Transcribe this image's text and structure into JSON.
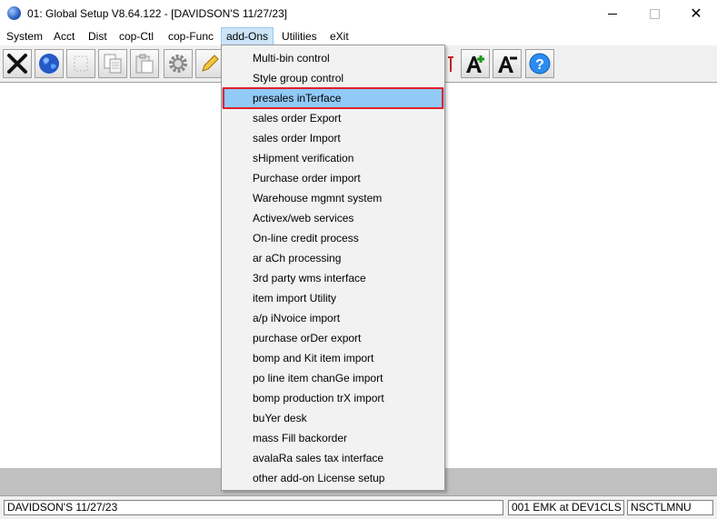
{
  "window": {
    "title": "01: Global Setup V8.64.122 - [DAVIDSON'S 11/27/23]",
    "minimize_glyph": "",
    "maximize_glyph": "",
    "close_glyph": "✕"
  },
  "menubar": {
    "items": [
      {
        "label": "System"
      },
      {
        "label": "Acct"
      },
      {
        "label": "Dist"
      },
      {
        "label": "cop-Ctl"
      },
      {
        "label": "cop-Func"
      },
      {
        "label": "add-Ons"
      },
      {
        "label": "Utilities"
      },
      {
        "label": "eXit"
      }
    ],
    "active_index": 5
  },
  "toolbar": {
    "icons": [
      "close-x-icon",
      "globe-icon",
      "blank-icon",
      "copy-icon",
      "paste-icon",
      "settings-gear-icon",
      "edit-pencil-icon",
      "text-icon",
      "font-increase-icon",
      "font-decrease-icon",
      "help-icon"
    ]
  },
  "dropdown": {
    "items": [
      {
        "label": "Multi-bin control"
      },
      {
        "label": "Style group control"
      },
      {
        "label": "presales inTerface"
      },
      {
        "label": "sales order Export"
      },
      {
        "label": "sales order Import"
      },
      {
        "label": "sHipment verification"
      },
      {
        "label": "Purchase order import"
      },
      {
        "label": "Warehouse mgmnt system"
      },
      {
        "label": "Activex/web services"
      },
      {
        "label": "On-line credit process"
      },
      {
        "label": "ar aCh processing"
      },
      {
        "label": "3rd party wms interface"
      },
      {
        "label": "item import Utility"
      },
      {
        "label": "a/p iNvoice import"
      },
      {
        "label": "purchase orDer export"
      },
      {
        "label": "bomp and Kit item import"
      },
      {
        "label": "po line item chanGe import"
      },
      {
        "label": "bomp production trX import"
      },
      {
        "label": "buYer desk"
      },
      {
        "label": "mass Fill backorder"
      },
      {
        "label": "avalaRa sales tax interface"
      },
      {
        "label": "other add-on License setup"
      }
    ],
    "highlighted_index": 2
  },
  "statusbar": {
    "company": "DAVIDSON'S 11/27/23",
    "session": "001 EMK at DEV1CLS",
    "program": "NSCTLMNU"
  },
  "colors": {
    "highlight": "#91c9f7",
    "highlight_border": "#e0202a",
    "menu_active": "#cce4f7"
  }
}
